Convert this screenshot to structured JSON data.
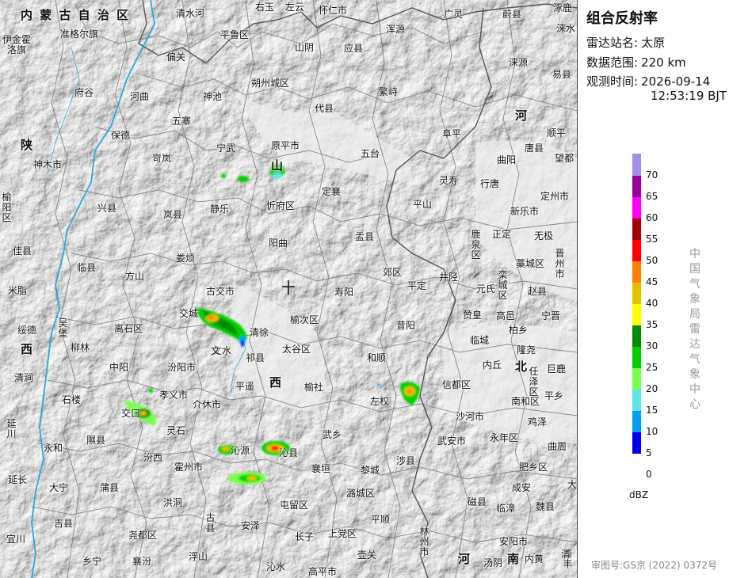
{
  "panel": {
    "title": "组合反射率",
    "station_label": "雷达站名:",
    "station_value": "太原",
    "range_label": "数据范围:",
    "range_value": "220 km",
    "time_label": "观测时间:",
    "time_date": "2026-09-14",
    "time_clock": "12:53:19 BJT",
    "unit": "dBZ",
    "credit": "中国气象局雷达气象中心",
    "review_no": "审图号:GS京 (2022) 0372号"
  },
  "legend": {
    "colors": [
      "#a58ee8",
      "#9a00a0",
      "#ff00ff",
      "#a60000",
      "#ff0000",
      "#ff8000",
      "#e6c000",
      "#ffff00",
      "#008c00",
      "#00d000",
      "#78ff50",
      "#5ee6e6",
      "#00a0f0",
      "#0000f0"
    ],
    "ticks": [
      "70",
      "65",
      "60",
      "55",
      "50",
      "45",
      "40",
      "35",
      "30",
      "25",
      "20",
      "15",
      "10",
      "5",
      "0"
    ]
  },
  "provinces": [
    {
      "id": "nmg",
      "text": "内 蒙 古 自 治 区"
    },
    {
      "id": "shaanxi",
      "text": "陕"
    },
    {
      "id": "shaanxi2",
      "text": "西"
    },
    {
      "id": "shanxi1",
      "text": "山"
    },
    {
      "id": "shanxi2",
      "text": "西"
    },
    {
      "id": "hebei1",
      "text": "河"
    },
    {
      "id": "hebei2",
      "text": "北"
    },
    {
      "id": "henan1",
      "text": "河"
    },
    {
      "id": "henan2",
      "text": "南"
    }
  ],
  "places": [
    "清水河",
    "右玉",
    "左云",
    "怀仁市",
    "广灵",
    "蔚县",
    "涿鹿",
    "伊金霍洛旗",
    "准格尔旗",
    "平鲁区",
    "涞水",
    "偏关",
    "山阴",
    "应县",
    "浑源",
    "涞源",
    "易县",
    "府谷",
    "河曲",
    "神池",
    "朔州城区",
    "繁峙",
    "代县",
    "五寨",
    "保德",
    "宁武",
    "原平市",
    "五台",
    "阜平",
    "唐县",
    "顺平",
    "神木市",
    "岢岚",
    "定襄",
    "曲阳",
    "望都",
    "静乐",
    "忻府区",
    "灵寿",
    "行唐",
    "定州市",
    "榆阳区",
    "兴县",
    "岚县",
    "平山",
    "新乐市",
    "阳曲",
    "盂县",
    "正定",
    "无极",
    "佳县",
    "临县",
    "娄烦",
    "鹿泉区",
    "藁城区",
    "晋州市",
    "方山",
    "古交市",
    "郊区",
    "井陉",
    "栾城区",
    "赵县",
    "米脂",
    "寿阳",
    "平定",
    "元氏",
    "绥德",
    "离石区",
    "交城",
    "清徐",
    "榆次区",
    "昔阳",
    "赞皇",
    "高邑",
    "宁晋",
    "吴堡",
    "柳林",
    "文水",
    "太谷区",
    "柏乡",
    "临城",
    "隆尧",
    "巨鹿",
    "清涧",
    "中阳",
    "汾阳市",
    "祁县",
    "和顺",
    "内丘",
    "任泽区",
    "平遥",
    "榆社",
    "信都区",
    "平乡",
    "南和区",
    "石楼",
    "孝义市",
    "介休市",
    "左权",
    "沙河市",
    "鸡泽",
    "延川",
    "交口",
    "灵石",
    "沁源",
    "武乡",
    "武安市",
    "永年区",
    "曲周",
    "永和",
    "隰县",
    "汾西",
    "霍州市",
    "襄垣",
    "黎城",
    "涉县",
    "肥乡区",
    "延长",
    "大宁",
    "蒲县",
    "洪洞",
    "屯留区",
    "潞城区",
    "磁县",
    "成安",
    "魏县",
    "临漳",
    "吉县",
    "古县",
    "安泽",
    "平顺",
    "尧都区",
    "宜川",
    "长子",
    "上党区",
    "壶关",
    "林州市",
    "安阳市",
    "乡宁",
    "襄汾",
    "浮山",
    "沁水",
    "高平市",
    "汤阴",
    "内黄",
    "清丰",
    "大名",
    "清",
    "沁县",
    "文"
  ]
}
